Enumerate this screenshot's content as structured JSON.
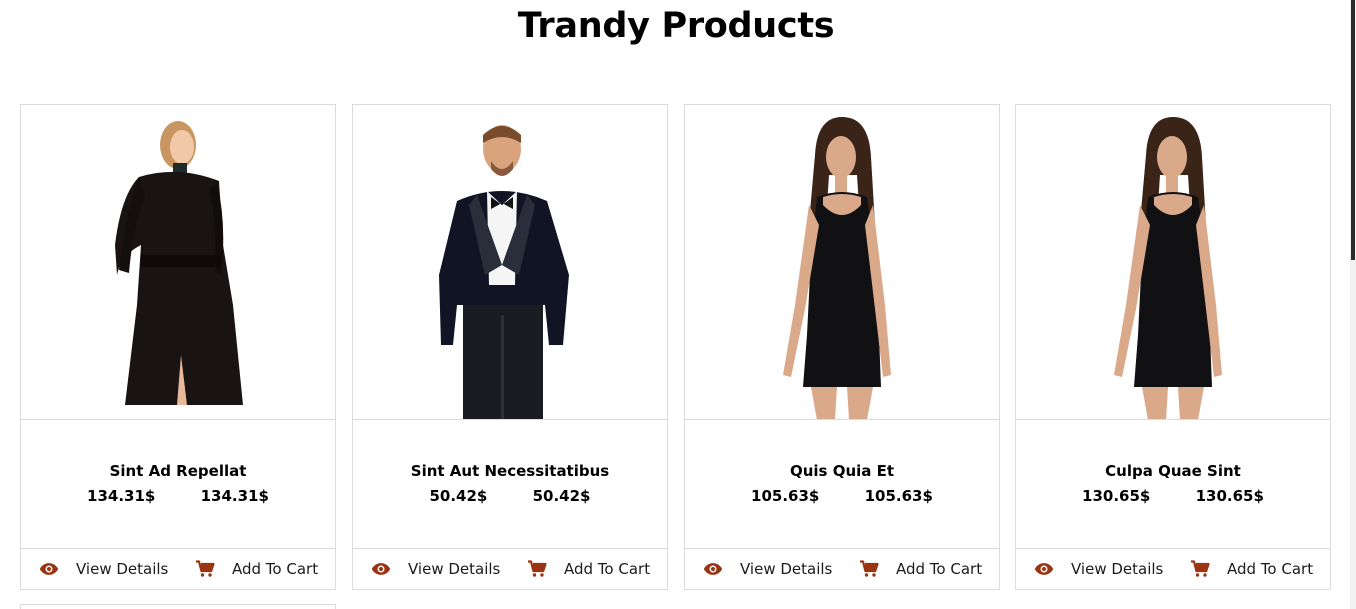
{
  "page": {
    "title": "Trandy Products"
  },
  "products": [
    {
      "name": "Sint Ad Repellat",
      "price": "134.31$",
      "old_price": "134.31$",
      "view_label": "View Details",
      "cart_label": "Add To Cart",
      "image": "woman-black-coat"
    },
    {
      "name": "Sint Aut Necessitatibus",
      "price": "50.42$",
      "old_price": "50.42$",
      "view_label": "View Details",
      "cart_label": "Add To Cart",
      "image": "man-tuxedo"
    },
    {
      "name": "Quis Quia Et",
      "price": "105.63$",
      "old_price": "105.63$",
      "view_label": "View Details",
      "cart_label": "Add To Cart",
      "image": "woman-black-dress"
    },
    {
      "name": "Culpa Quae Sint",
      "price": "130.65$",
      "old_price": "130.65$",
      "view_label": "View Details",
      "cart_label": "Add To Cart",
      "image": "woman-black-dress"
    }
  ],
  "icons": {
    "view": "eye-icon",
    "cart": "cart-icon"
  },
  "colors": {
    "icon_accent": "#9a3412",
    "border": "#dcdcdc",
    "text": "#1b1b1b"
  }
}
